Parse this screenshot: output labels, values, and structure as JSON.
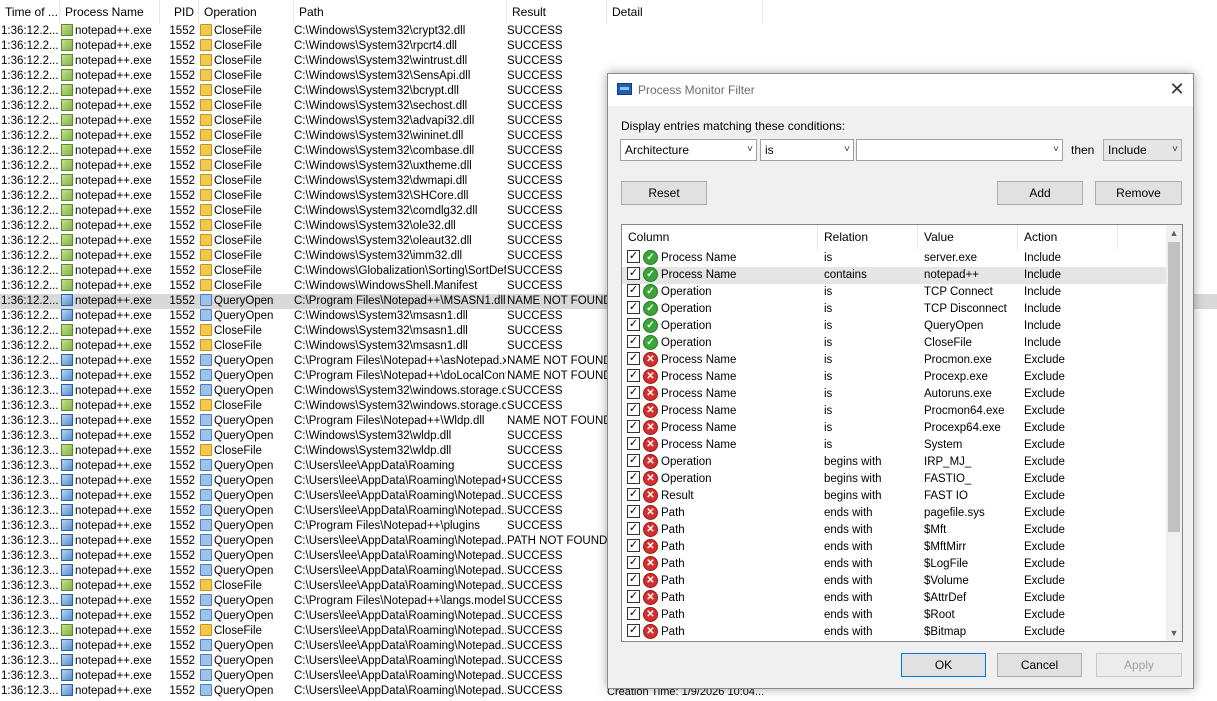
{
  "event_list": {
    "columns": [
      "Time of ...",
      "Process Name",
      "PID",
      "Operation",
      "Path",
      "Result",
      "Detail"
    ],
    "rows": [
      {
        "time": "1:36:12.2...",
        "proc": "notepad++.exe",
        "pid": "1552",
        "op": "CloseFile",
        "path": "C:\\Windows\\System32\\crypt32.dll",
        "result": "SUCCESS",
        "q": false,
        "sel": false
      },
      {
        "time": "1:36:12.2...",
        "proc": "notepad++.exe",
        "pid": "1552",
        "op": "CloseFile",
        "path": "C:\\Windows\\System32\\rpcrt4.dll",
        "result": "SUCCESS",
        "q": false,
        "sel": false
      },
      {
        "time": "1:36:12.2...",
        "proc": "notepad++.exe",
        "pid": "1552",
        "op": "CloseFile",
        "path": "C:\\Windows\\System32\\wintrust.dll",
        "result": "SUCCESS",
        "q": false,
        "sel": false
      },
      {
        "time": "1:36:12.2...",
        "proc": "notepad++.exe",
        "pid": "1552",
        "op": "CloseFile",
        "path": "C:\\Windows\\System32\\SensApi.dll",
        "result": "SUCCESS",
        "q": false,
        "sel": false
      },
      {
        "time": "1:36:12.2...",
        "proc": "notepad++.exe",
        "pid": "1552",
        "op": "CloseFile",
        "path": "C:\\Windows\\System32\\bcrypt.dll",
        "result": "SUCCESS",
        "q": false,
        "sel": false
      },
      {
        "time": "1:36:12.2...",
        "proc": "notepad++.exe",
        "pid": "1552",
        "op": "CloseFile",
        "path": "C:\\Windows\\System32\\sechost.dll",
        "result": "SUCCESS",
        "q": false,
        "sel": false
      },
      {
        "time": "1:36:12.2...",
        "proc": "notepad++.exe",
        "pid": "1552",
        "op": "CloseFile",
        "path": "C:\\Windows\\System32\\advapi32.dll",
        "result": "SUCCESS",
        "q": false,
        "sel": false
      },
      {
        "time": "1:36:12.2...",
        "proc": "notepad++.exe",
        "pid": "1552",
        "op": "CloseFile",
        "path": "C:\\Windows\\System32\\wininet.dll",
        "result": "SUCCESS",
        "q": false,
        "sel": false
      },
      {
        "time": "1:36:12.2...",
        "proc": "notepad++.exe",
        "pid": "1552",
        "op": "CloseFile",
        "path": "C:\\Windows\\System32\\combase.dll",
        "result": "SUCCESS",
        "q": false,
        "sel": false
      },
      {
        "time": "1:36:12.2...",
        "proc": "notepad++.exe",
        "pid": "1552",
        "op": "CloseFile",
        "path": "C:\\Windows\\System32\\uxtheme.dll",
        "result": "SUCCESS",
        "q": false,
        "sel": false
      },
      {
        "time": "1:36:12.2...",
        "proc": "notepad++.exe",
        "pid": "1552",
        "op": "CloseFile",
        "path": "C:\\Windows\\System32\\dwmapi.dll",
        "result": "SUCCESS",
        "q": false,
        "sel": false
      },
      {
        "time": "1:36:12.2...",
        "proc": "notepad++.exe",
        "pid": "1552",
        "op": "CloseFile",
        "path": "C:\\Windows\\System32\\SHCore.dll",
        "result": "SUCCESS",
        "q": false,
        "sel": false
      },
      {
        "time": "1:36:12.2...",
        "proc": "notepad++.exe",
        "pid": "1552",
        "op": "CloseFile",
        "path": "C:\\Windows\\System32\\comdlg32.dll",
        "result": "SUCCESS",
        "q": false,
        "sel": false
      },
      {
        "time": "1:36:12.2...",
        "proc": "notepad++.exe",
        "pid": "1552",
        "op": "CloseFile",
        "path": "C:\\Windows\\System32\\ole32.dll",
        "result": "SUCCESS",
        "q": false,
        "sel": false
      },
      {
        "time": "1:36:12.2...",
        "proc": "notepad++.exe",
        "pid": "1552",
        "op": "CloseFile",
        "path": "C:\\Windows\\System32\\oleaut32.dll",
        "result": "SUCCESS",
        "q": false,
        "sel": false
      },
      {
        "time": "1:36:12.2...",
        "proc": "notepad++.exe",
        "pid": "1552",
        "op": "CloseFile",
        "path": "C:\\Windows\\System32\\imm32.dll",
        "result": "SUCCESS",
        "q": false,
        "sel": false
      },
      {
        "time": "1:36:12.2...",
        "proc": "notepad++.exe",
        "pid": "1552",
        "op": "CloseFile",
        "path": "C:\\Windows\\Globalization\\Sorting\\SortDef...",
        "result": "SUCCESS",
        "q": false,
        "sel": false
      },
      {
        "time": "1:36:12.2...",
        "proc": "notepad++.exe",
        "pid": "1552",
        "op": "CloseFile",
        "path": "C:\\Windows\\WindowsShell.Manifest",
        "result": "SUCCESS",
        "q": false,
        "sel": false
      },
      {
        "time": "1:36:12.2...",
        "proc": "notepad++.exe",
        "pid": "1552",
        "op": "QueryOpen",
        "path": "C:\\Program Files\\Notepad++\\MSASN1.dll",
        "result": "NAME NOT FOUND",
        "q": true,
        "sel": true
      },
      {
        "time": "1:36:12.2...",
        "proc": "notepad++.exe",
        "pid": "1552",
        "op": "QueryOpen",
        "path": "C:\\Windows\\System32\\msasn1.dll",
        "result": "SUCCESS",
        "q": true,
        "sel": false
      },
      {
        "time": "1:36:12.2...",
        "proc": "notepad++.exe",
        "pid": "1552",
        "op": "CloseFile",
        "path": "C:\\Windows\\System32\\msasn1.dll",
        "result": "SUCCESS",
        "q": false,
        "sel": false
      },
      {
        "time": "1:36:12.2...",
        "proc": "notepad++.exe",
        "pid": "1552",
        "op": "CloseFile",
        "path": "C:\\Windows\\System32\\msasn1.dll",
        "result": "SUCCESS",
        "q": false,
        "sel": false
      },
      {
        "time": "1:36:12.2...",
        "proc": "notepad++.exe",
        "pid": "1552",
        "op": "QueryOpen",
        "path": "C:\\Program Files\\Notepad++\\asNotepad.xml",
        "result": "NAME NOT FOUND",
        "q": true,
        "sel": false
      },
      {
        "time": "1:36:12.3...",
        "proc": "notepad++.exe",
        "pid": "1552",
        "op": "QueryOpen",
        "path": "C:\\Program Files\\Notepad++\\doLocalConf....",
        "result": "NAME NOT FOUND",
        "q": true,
        "sel": false
      },
      {
        "time": "1:36:12.3...",
        "proc": "notepad++.exe",
        "pid": "1552",
        "op": "QueryOpen",
        "path": "C:\\Windows\\System32\\windows.storage.dll",
        "result": "SUCCESS",
        "q": true,
        "sel": false
      },
      {
        "time": "1:36:12.3...",
        "proc": "notepad++.exe",
        "pid": "1552",
        "op": "CloseFile",
        "path": "C:\\Windows\\System32\\windows.storage.dll",
        "result": "SUCCESS",
        "q": false,
        "sel": false
      },
      {
        "time": "1:36:12.3...",
        "proc": "notepad++.exe",
        "pid": "1552",
        "op": "QueryOpen",
        "path": "C:\\Program Files\\Notepad++\\Wldp.dll",
        "result": "NAME NOT FOUND",
        "q": true,
        "sel": false
      },
      {
        "time": "1:36:12.3...",
        "proc": "notepad++.exe",
        "pid": "1552",
        "op": "QueryOpen",
        "path": "C:\\Windows\\System32\\wldp.dll",
        "result": "SUCCESS",
        "q": true,
        "sel": false
      },
      {
        "time": "1:36:12.3...",
        "proc": "notepad++.exe",
        "pid": "1552",
        "op": "CloseFile",
        "path": "C:\\Windows\\System32\\wldp.dll",
        "result": "SUCCESS",
        "q": false,
        "sel": false
      },
      {
        "time": "1:36:12.3...",
        "proc": "notepad++.exe",
        "pid": "1552",
        "op": "QueryOpen",
        "path": "C:\\Users\\lee\\AppData\\Roaming",
        "result": "SUCCESS",
        "q": true,
        "sel": false
      },
      {
        "time": "1:36:12.3...",
        "proc": "notepad++.exe",
        "pid": "1552",
        "op": "QueryOpen",
        "path": "C:\\Users\\lee\\AppData\\Roaming\\Notepad++",
        "result": "SUCCESS",
        "q": true,
        "sel": false
      },
      {
        "time": "1:36:12.3...",
        "proc": "notepad++.exe",
        "pid": "1552",
        "op": "QueryOpen",
        "path": "C:\\Users\\lee\\AppData\\Roaming\\Notepad...",
        "result": "SUCCESS",
        "q": true,
        "sel": false
      },
      {
        "time": "1:36:12.3...",
        "proc": "notepad++.exe",
        "pid": "1552",
        "op": "QueryOpen",
        "path": "C:\\Users\\lee\\AppData\\Roaming\\Notepad...",
        "result": "SUCCESS",
        "q": true,
        "sel": false
      },
      {
        "time": "1:36:12.3...",
        "proc": "notepad++.exe",
        "pid": "1552",
        "op": "QueryOpen",
        "path": "C:\\Program Files\\Notepad++\\plugins",
        "result": "SUCCESS",
        "q": true,
        "sel": false
      },
      {
        "time": "1:36:12.3...",
        "proc": "notepad++.exe",
        "pid": "1552",
        "op": "QueryOpen",
        "path": "C:\\Users\\lee\\AppData\\Roaming\\Notepad...",
        "result": "PATH NOT FOUND",
        "q": true,
        "sel": false
      },
      {
        "time": "1:36:12.3...",
        "proc": "notepad++.exe",
        "pid": "1552",
        "op": "QueryOpen",
        "path": "C:\\Users\\lee\\AppData\\Roaming\\Notepad...",
        "result": "SUCCESS",
        "q": true,
        "sel": false
      },
      {
        "time": "1:36:12.3...",
        "proc": "notepad++.exe",
        "pid": "1552",
        "op": "QueryOpen",
        "path": "C:\\Users\\lee\\AppData\\Roaming\\Notepad...",
        "result": "SUCCESS",
        "q": true,
        "sel": false
      },
      {
        "time": "1:36:12.3...",
        "proc": "notepad++.exe",
        "pid": "1552",
        "op": "CloseFile",
        "path": "C:\\Users\\lee\\AppData\\Roaming\\Notepad...",
        "result": "SUCCESS",
        "q": false,
        "sel": false
      },
      {
        "time": "1:36:12.3...",
        "proc": "notepad++.exe",
        "pid": "1552",
        "op": "QueryOpen",
        "path": "C:\\Program Files\\Notepad++\\langs.model....",
        "result": "SUCCESS",
        "q": true,
        "sel": false
      },
      {
        "time": "1:36:12.3...",
        "proc": "notepad++.exe",
        "pid": "1552",
        "op": "QueryOpen",
        "path": "C:\\Users\\lee\\AppData\\Roaming\\Notepad...",
        "result": "SUCCESS",
        "q": true,
        "sel": false
      },
      {
        "time": "1:36:12.3...",
        "proc": "notepad++.exe",
        "pid": "1552",
        "op": "CloseFile",
        "path": "C:\\Users\\lee\\AppData\\Roaming\\Notepad...",
        "result": "SUCCESS",
        "q": false,
        "sel": false
      },
      {
        "time": "1:36:12.3...",
        "proc": "notepad++.exe",
        "pid": "1552",
        "op": "QueryOpen",
        "path": "C:\\Users\\lee\\AppData\\Roaming\\Notepad...",
        "result": "SUCCESS",
        "q": true,
        "sel": false
      },
      {
        "time": "1:36:12.3...",
        "proc": "notepad++.exe",
        "pid": "1552",
        "op": "QueryOpen",
        "path": "C:\\Users\\lee\\AppData\\Roaming\\Notepad...",
        "result": "SUCCESS",
        "q": true,
        "sel": false
      },
      {
        "time": "1:36:12.3...",
        "proc": "notepad++.exe",
        "pid": "1552",
        "op": "QueryOpen",
        "path": "C:\\Users\\lee\\AppData\\Roaming\\Notepad...",
        "result": "SUCCESS",
        "q": true,
        "sel": false
      },
      {
        "time": "1:36:12.3...",
        "proc": "notepad++.exe",
        "pid": "1552",
        "op": "QueryOpen",
        "path": "C:\\Users\\lee\\AppData\\Roaming\\Notepad...",
        "result": "SUCCESS",
        "q": true,
        "sel": false
      }
    ],
    "status_fragment": "Creation Time: 1/9/2026 10:04..."
  },
  "dialog": {
    "title": "Process Monitor Filter",
    "close_glyph": "✕",
    "prompt": "Display entries matching these conditions:",
    "column_combo": "Architecture",
    "relation_combo": "is",
    "value_combo": "",
    "then_label": "then",
    "action_combo": "Include",
    "reset_label": "Reset",
    "add_label": "Add",
    "remove_label": "Remove",
    "ok_label": "OK",
    "cancel_label": "Cancel",
    "apply_label": "Apply",
    "list_columns": [
      "Column",
      "Relation",
      "Value",
      "Action"
    ],
    "filters": [
      {
        "column": "Process Name",
        "relation": "is",
        "value": "server.exe",
        "action": "Include"
      },
      {
        "column": "Process Name",
        "relation": "contains",
        "value": "notepad++",
        "action": "Include"
      },
      {
        "column": "Operation",
        "relation": "is",
        "value": "TCP Connect",
        "action": "Include"
      },
      {
        "column": "Operation",
        "relation": "is",
        "value": "TCP Disconnect",
        "action": "Include"
      },
      {
        "column": "Operation",
        "relation": "is",
        "value": "QueryOpen",
        "action": "Include"
      },
      {
        "column": "Operation",
        "relation": "is",
        "value": "CloseFile",
        "action": "Include"
      },
      {
        "column": "Process Name",
        "relation": "is",
        "value": "Procmon.exe",
        "action": "Exclude"
      },
      {
        "column": "Process Name",
        "relation": "is",
        "value": "Procexp.exe",
        "action": "Exclude"
      },
      {
        "column": "Process Name",
        "relation": "is",
        "value": "Autoruns.exe",
        "action": "Exclude"
      },
      {
        "column": "Process Name",
        "relation": "is",
        "value": "Procmon64.exe",
        "action": "Exclude"
      },
      {
        "column": "Process Name",
        "relation": "is",
        "value": "Procexp64.exe",
        "action": "Exclude"
      },
      {
        "column": "Process Name",
        "relation": "is",
        "value": "System",
        "action": "Exclude"
      },
      {
        "column": "Operation",
        "relation": "begins with",
        "value": "IRP_MJ_",
        "action": "Exclude"
      },
      {
        "column": "Operation",
        "relation": "begins with",
        "value": "FASTIO_",
        "action": "Exclude"
      },
      {
        "column": "Result",
        "relation": "begins with",
        "value": "FAST IO",
        "action": "Exclude"
      },
      {
        "column": "Path",
        "relation": "ends with",
        "value": "pagefile.sys",
        "action": "Exclude"
      },
      {
        "column": "Path",
        "relation": "ends with",
        "value": "$Mft",
        "action": "Exclude"
      },
      {
        "column": "Path",
        "relation": "ends with",
        "value": "$MftMirr",
        "action": "Exclude"
      },
      {
        "column": "Path",
        "relation": "ends with",
        "value": "$LogFile",
        "action": "Exclude"
      },
      {
        "column": "Path",
        "relation": "ends with",
        "value": "$Volume",
        "action": "Exclude"
      },
      {
        "column": "Path",
        "relation": "ends with",
        "value": "$AttrDef",
        "action": "Exclude"
      },
      {
        "column": "Path",
        "relation": "ends with",
        "value": "$Root",
        "action": "Exclude"
      },
      {
        "column": "Path",
        "relation": "ends with",
        "value": "$Bitmap",
        "action": "Exclude"
      }
    ],
    "highlighted_filter_index": 1
  }
}
